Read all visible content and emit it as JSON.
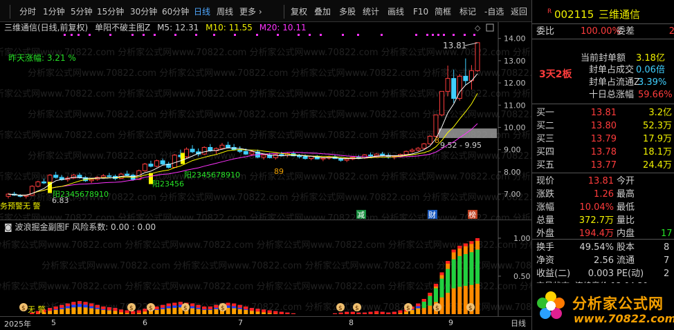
{
  "toolbar": {
    "items": [
      "分时",
      "1分钟",
      "5分钟",
      "15分钟",
      "30分钟",
      "60分钟",
      "日线",
      "周线",
      "更多 ›",
      "复权",
      "叠加",
      "多股",
      "统计",
      "画线",
      "F10",
      "简框",
      "标记",
      "-自选",
      "返回"
    ],
    "active": "日线"
  },
  "main_chart": {
    "stock_title": "三维通信(日线,前复权)",
    "indicator_name": "单阳不破主图Z",
    "ma5": "M5: 12.31",
    "ma10": "M10: 11.55",
    "ma20": "M20: 10.11",
    "yesterday_rise": "昨天涨幅: 3.21 %",
    "high_label": "13.81",
    "low_label": "6.83",
    "range_label": "9.52 - 9.95",
    "annotation_yang1": "阳2345678910",
    "annotation_yang2": "阳23456",
    "annotation_yang3": "阳2345678910",
    "annotation_89": "89",
    "annotation_8": "8",
    "annotation_warn": "务预警无  警",
    "event_jian": "减",
    "event_cai": "财",
    "event_bang": "榜",
    "price_axis": [
      "14.00",
      "13.00",
      "12.00",
      "11.00",
      "10.00",
      "9.00",
      "8.00",
      "7.00"
    ],
    "candles": [
      [
        6.9,
        7.05,
        6.8,
        7.0
      ],
      [
        7.0,
        7.1,
        6.92,
        6.95
      ],
      [
        6.95,
        7.0,
        6.85,
        6.9
      ],
      [
        6.9,
        6.98,
        6.8,
        6.95
      ],
      [
        6.95,
        7.4,
        6.92,
        7.35
      ],
      [
        7.35,
        7.6,
        7.3,
        7.55
      ],
      [
        7.55,
        7.7,
        7.45,
        7.5
      ],
      [
        7.5,
        7.9,
        7.48,
        7.85
      ],
      [
        7.85,
        8.0,
        7.7,
        7.75
      ],
      [
        7.75,
        7.85,
        7.6,
        7.65
      ],
      [
        7.65,
        7.8,
        7.55,
        7.72
      ],
      [
        7.72,
        7.9,
        7.68,
        7.85
      ],
      [
        7.85,
        7.95,
        7.7,
        7.74
      ],
      [
        7.74,
        7.8,
        7.55,
        7.6
      ],
      [
        7.6,
        7.7,
        7.5,
        7.66
      ],
      [
        7.66,
        7.8,
        7.6,
        7.75
      ],
      [
        7.75,
        7.9,
        7.7,
        7.82
      ],
      [
        7.82,
        7.95,
        7.75,
        7.8
      ],
      [
        7.8,
        7.88,
        7.62,
        7.7
      ],
      [
        7.7,
        7.95,
        7.68,
        7.9
      ],
      [
        7.9,
        8.05,
        7.82,
        7.85
      ],
      [
        7.85,
        7.92,
        7.6,
        7.66
      ],
      [
        7.66,
        8.1,
        7.64,
        8.05
      ],
      [
        8.05,
        8.4,
        8.0,
        8.35
      ],
      [
        8.35,
        8.5,
        8.2,
        8.25
      ],
      [
        8.25,
        8.55,
        8.2,
        8.5
      ],
      [
        8.5,
        8.6,
        8.3,
        8.35
      ],
      [
        8.35,
        8.45,
        8.15,
        8.2
      ],
      [
        8.2,
        8.8,
        8.18,
        8.75
      ],
      [
        8.75,
        9.0,
        8.6,
        8.68
      ],
      [
        8.68,
        9.1,
        8.6,
        9.02
      ],
      [
        9.02,
        9.2,
        8.85,
        8.9
      ],
      [
        8.9,
        9.05,
        8.7,
        8.8
      ],
      [
        8.8,
        9.15,
        8.75,
        9.1
      ],
      [
        9.1,
        9.25,
        8.9,
        8.95
      ],
      [
        8.95,
        9.1,
        8.8,
        9.05
      ],
      [
        9.05,
        9.3,
        9.0,
        9.2
      ],
      [
        9.2,
        9.35,
        9.05,
        9.1
      ],
      [
        9.1,
        9.25,
        8.95,
        9.0
      ],
      [
        9.0,
        9.15,
        8.85,
        8.92
      ],
      [
        8.92,
        9.05,
        8.75,
        8.8
      ],
      [
        8.8,
        8.95,
        8.7,
        8.9
      ],
      [
        8.9,
        9.0,
        8.62,
        8.66
      ],
      [
        8.66,
        8.8,
        8.55,
        8.75
      ],
      [
        8.75,
        8.85,
        8.6,
        8.64
      ],
      [
        8.64,
        8.8,
        8.55,
        8.78
      ],
      [
        8.78,
        8.9,
        8.7,
        8.74
      ],
      [
        8.74,
        8.86,
        8.66,
        8.82
      ],
      [
        8.82,
        8.92,
        8.7,
        8.72
      ],
      [
        8.72,
        8.8,
        8.6,
        8.68
      ],
      [
        8.68,
        8.78,
        8.55,
        8.6
      ],
      [
        8.6,
        8.72,
        8.52,
        8.7
      ],
      [
        8.7,
        8.76,
        8.56,
        8.58
      ],
      [
        8.58,
        8.66,
        8.48,
        8.62
      ],
      [
        8.62,
        8.72,
        8.55,
        8.68
      ],
      [
        8.68,
        8.76,
        8.58,
        8.6
      ],
      [
        8.6,
        8.66,
        8.46,
        8.52
      ],
      [
        8.52,
        8.62,
        8.44,
        8.58
      ],
      [
        8.58,
        8.7,
        8.52,
        8.66
      ],
      [
        8.66,
        8.75,
        8.58,
        8.62
      ],
      [
        8.62,
        8.8,
        8.58,
        8.76
      ],
      [
        8.76,
        8.86,
        8.68,
        8.72
      ],
      [
        8.72,
        8.84,
        8.64,
        8.8
      ],
      [
        8.8,
        8.9,
        8.7,
        8.74
      ],
      [
        8.74,
        8.84,
        8.6,
        8.66
      ],
      [
        8.66,
        8.76,
        8.56,
        8.7
      ],
      [
        8.7,
        8.82,
        8.64,
        8.78
      ],
      [
        8.78,
        8.96,
        8.74,
        8.92
      ],
      [
        8.92,
        9.06,
        8.86,
        8.98
      ],
      [
        8.98,
        9.12,
        8.92,
        9.06
      ],
      [
        9.06,
        9.3,
        9.02,
        9.26
      ],
      [
        9.26,
        9.65,
        9.22,
        9.6
      ],
      [
        9.6,
        10.56,
        9.55,
        10.56
      ],
      [
        10.56,
        11.62,
        10.5,
        11.62
      ],
      [
        11.62,
        12.78,
        11.4,
        12.2
      ],
      [
        12.2,
        12.6,
        11.1,
        11.3
      ],
      [
        11.3,
        12.4,
        11.2,
        12.3
      ],
      [
        12.3,
        13.1,
        11.9,
        12.1
      ],
      [
        12.1,
        12.8,
        11.7,
        12.55
      ],
      [
        12.55,
        13.81,
        12.5,
        13.81
      ]
    ]
  },
  "sub_chart": {
    "title": "波浪掘金副图F",
    "risk": "风险系数: 0.00 : 0.00",
    "axis": [
      "1.00",
      "0.50"
    ],
    "money_label": "无  警",
    "bars": [
      0.0,
      0.0,
      0.0,
      0.0,
      0.02,
      0.04,
      0.06,
      0.08,
      0.1,
      0.12,
      0.14,
      0.16,
      0.17,
      0.16,
      0.14,
      0.12,
      0.1,
      0.09,
      0.08,
      0.06,
      0.05,
      0.04,
      0.05,
      0.07,
      0.09,
      0.1,
      0.12,
      0.14,
      0.15,
      0.16,
      0.15,
      0.14,
      0.12,
      0.1,
      0.1,
      0.12,
      0.14,
      0.15,
      0.14,
      0.12,
      0.1,
      0.08,
      0.07,
      0.06,
      0.05,
      0.04,
      0.03,
      0.02,
      0.01,
      0.0,
      0.0,
      0.0,
      0.0,
      0.0,
      0.0,
      0.01,
      0.02,
      0.03,
      0.03,
      0.02,
      0.02,
      0.03,
      0.04,
      0.03,
      0.02,
      0.03,
      0.05,
      0.07,
      0.1,
      0.14,
      0.2,
      0.28,
      0.4,
      0.55,
      0.7,
      0.85,
      0.9,
      0.93,
      0.96,
      1.0
    ]
  },
  "date_axis": [
    "2025年",
    "5",
    "6",
    "7",
    "8",
    "9"
  ],
  "date_range_button": "日线",
  "quote": {
    "code": "002115",
    "name": "三维通信",
    "r_badge": "R",
    "wei_bi_label": "委比",
    "wei_bi_value": "100.00%",
    "wei_cha_label": "委差",
    "wei_cha_value": "2",
    "board_tag": "3天2板",
    "seal_amount_label": "当前封单额",
    "seal_amount_value": "3.18亿",
    "seal_deal_label": "封单占成交",
    "seal_deal_value": "0.06倍",
    "seal_float_label": "封单占流通Z",
    "seal_float_value": "3.39%",
    "ten_day_label": "十日总涨幅",
    "ten_day_value": "59.66%",
    "bids": [
      {
        "label": "买一",
        "price": "13.81",
        "vol": "3.2亿"
      },
      {
        "label": "买二",
        "price": "13.80",
        "vol": "52.3万"
      },
      {
        "label": "买三",
        "price": "13.79",
        "vol": "17.9万"
      },
      {
        "label": "买四",
        "price": "13.78",
        "vol": "18.1万"
      },
      {
        "label": "买五",
        "price": "13.77",
        "vol": "24.4万"
      }
    ],
    "stats": [
      {
        "l1": "现价",
        "v1": "13.81",
        "l2": "今开",
        "v2": ""
      },
      {
        "l1": "涨跌",
        "v1": "1.26",
        "l2": "最高",
        "v2": ""
      },
      {
        "l1": "涨幅",
        "v1": "10.04%",
        "l2": "最低",
        "v2": ""
      },
      {
        "l1": "总量",
        "v1": "372.7万",
        "l2": "量比",
        "v2": ""
      },
      {
        "l1": "外盘",
        "v1": "194.4万",
        "l2": "内盘",
        "v2": "17"
      }
    ],
    "stats2": [
      {
        "l1": "换手",
        "v1": "49.54%",
        "l2": "股本",
        "v2": "8"
      },
      {
        "l1": "净资",
        "v1": "2.56",
        "l2": "流通",
        "v2": "7"
      },
      {
        "l1": "收益(二)",
        "v1": "0.003",
        "l2": "PE(动)",
        "v2": "2"
      }
    ],
    "trade_status": "交易状态: 连续竞价 13:04:30"
  },
  "logo": {
    "text": "分析家公式网",
    "url": "www.70822.com"
  },
  "watermark": "分析家公式网www.70822.com"
}
